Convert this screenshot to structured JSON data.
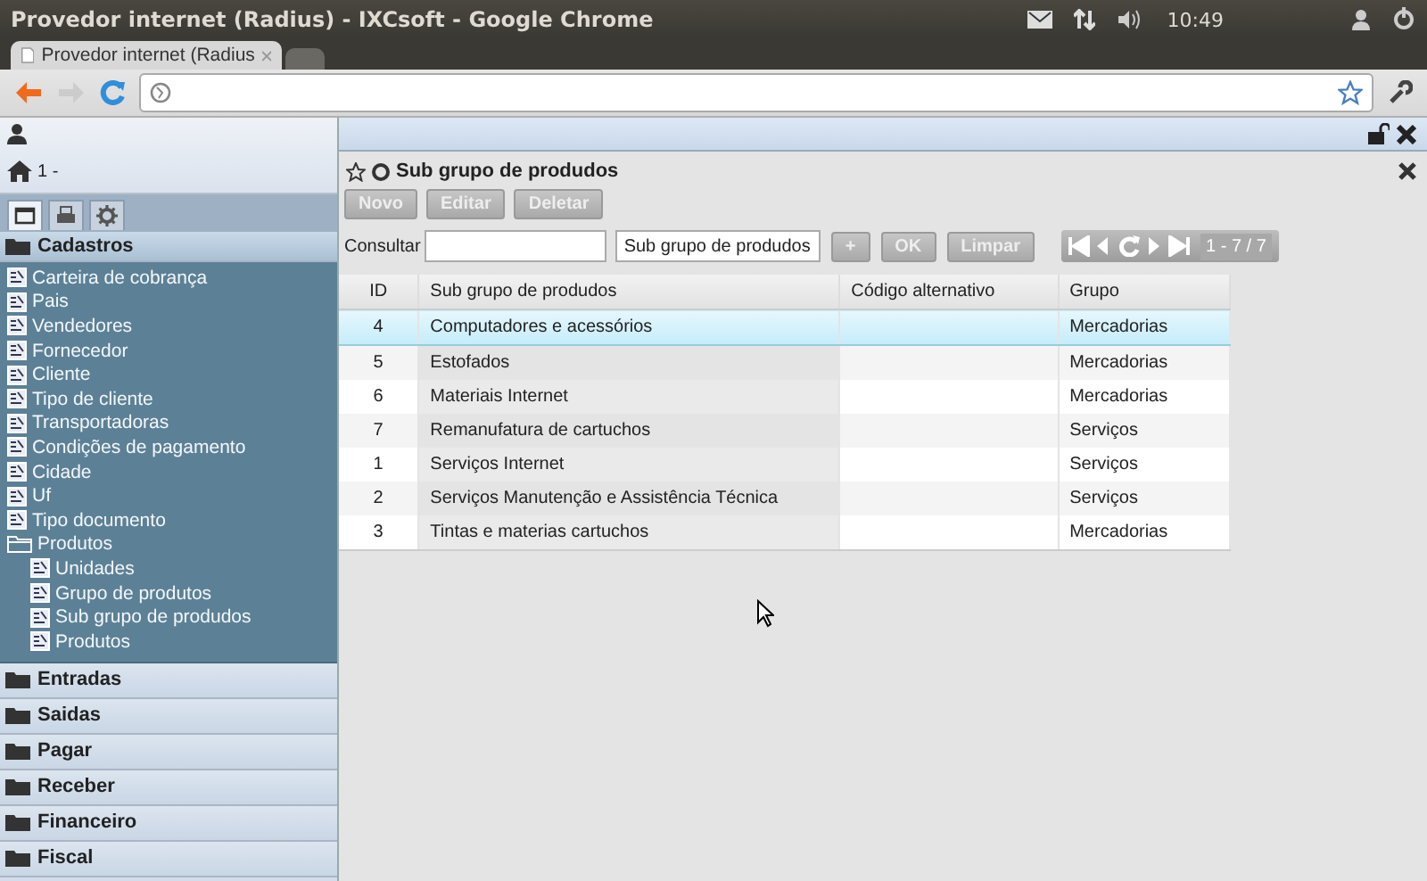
{
  "os_bar": {
    "title": "Provedor internet (Radius) - IXCsoft - Google Chrome",
    "clock": "10:49"
  },
  "browser": {
    "tabs": [
      {
        "label": "Provedor internet (Radius",
        "selected": true
      },
      {
        "selected": false
      }
    ]
  },
  "sidebar": {
    "company": "1 -",
    "tabs": [
      {
        "kind": "window",
        "selected": true
      },
      {
        "kind": "print",
        "selected": false
      },
      {
        "kind": "gear",
        "selected": false
      }
    ],
    "sections": [
      {
        "label": "Cadastros",
        "expanded": true,
        "items": [
          {
            "label": "Carteira de cobrança"
          },
          {
            "label": "Pais"
          },
          {
            "label": "Vendedores"
          },
          {
            "label": "Fornecedor"
          },
          {
            "label": "Cliente"
          },
          {
            "label": "Tipo de cliente"
          },
          {
            "label": "Transportadoras"
          },
          {
            "label": "Condições de pagamento"
          },
          {
            "label": "Cidade"
          },
          {
            "label": "Uf"
          },
          {
            "label": "Tipo documento"
          },
          {
            "label": "Produtos",
            "expanded": true,
            "children": [
              {
                "label": "Unidades"
              },
              {
                "label": "Grupo de produtos"
              },
              {
                "label": "Sub grupo de produdos"
              },
              {
                "label": "Produtos"
              }
            ]
          }
        ]
      },
      {
        "label": "Entradas",
        "expanded": false
      },
      {
        "label": "Saidas",
        "expanded": false
      },
      {
        "label": "Pagar",
        "expanded": false
      },
      {
        "label": "Receber",
        "expanded": false
      },
      {
        "label": "Financeiro",
        "expanded": false
      },
      {
        "label": "Fiscal",
        "expanded": false
      }
    ]
  },
  "panel": {
    "title": "Sub grupo de produdos",
    "buttons": [
      "Novo",
      "Editar",
      "Deletar"
    ],
    "search": {
      "label": "Consultar",
      "select": "Sub grupo de produdos",
      "buttons": [
        "+",
        "OK",
        "Limpar"
      ],
      "pager": "1 - 7 / 7"
    },
    "table": {
      "columns": [
        "ID",
        "Sub grupo de produdos",
        "Código alternativo",
        "Grupo"
      ],
      "rows": [
        {
          "cells": [
            "4",
            "Computadores e acessórios",
            "",
            "Mercadorias"
          ],
          "selected": true
        },
        {
          "cells": [
            "5",
            "Estofados",
            "",
            "Mercadorias"
          ],
          "selected": false
        },
        {
          "cells": [
            "6",
            "Materiais Internet",
            "",
            "Mercadorias"
          ],
          "selected": false
        },
        {
          "cells": [
            "7",
            "Remanufatura de cartuchos",
            "",
            "Serviços"
          ],
          "selected": false
        },
        {
          "cells": [
            "1",
            "Serviços Internet",
            "",
            "Serviços"
          ],
          "selected": false
        },
        {
          "cells": [
            "2",
            "Serviços Manutenção e Assistência Técnica",
            "",
            "Serviços"
          ],
          "selected": false
        },
        {
          "cells": [
            "3",
            "Tintas e materias cartuchos",
            "",
            "Mercadorias"
          ],
          "selected": false
        }
      ]
    }
  }
}
